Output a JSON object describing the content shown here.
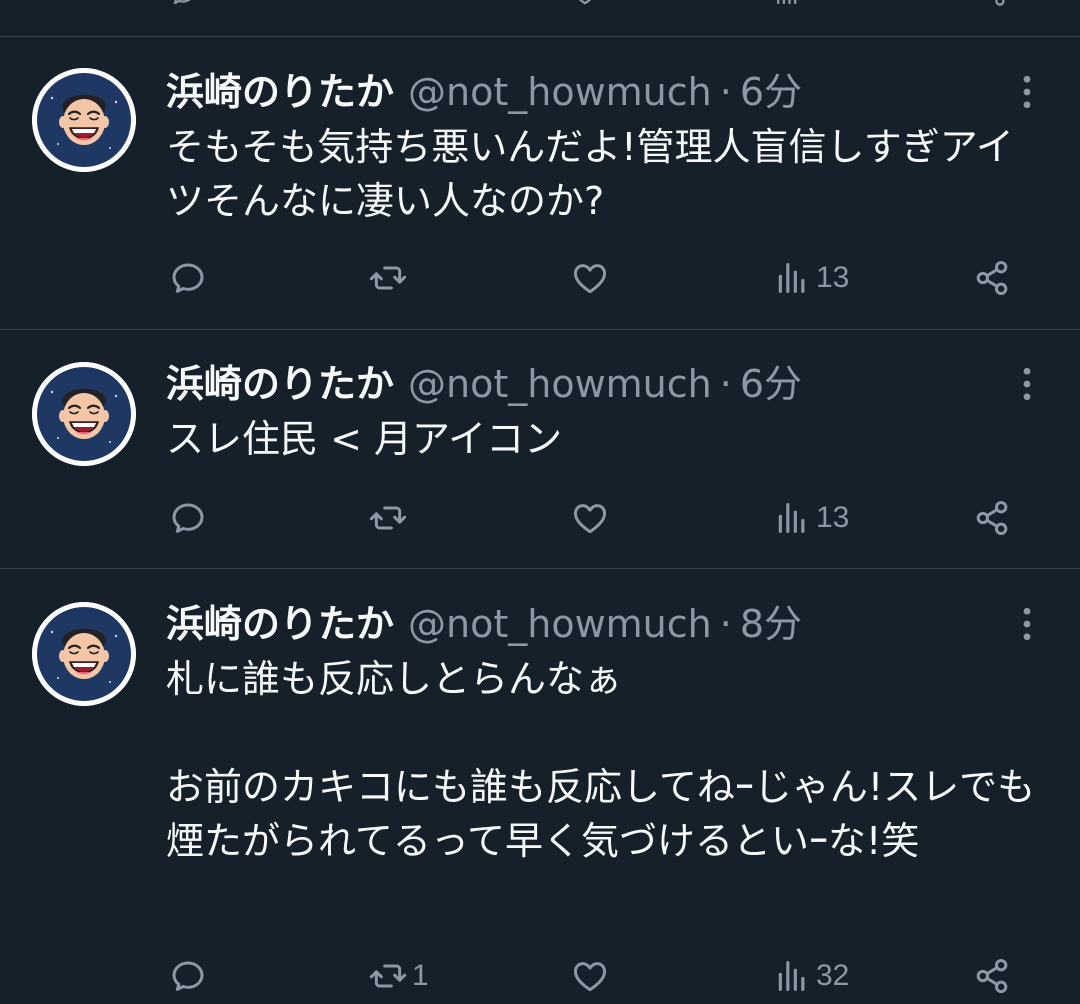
{
  "colors": {
    "background": "#15202b",
    "divider": "#38444d",
    "text": "#f7f9f9",
    "muted": "#8b98a5"
  },
  "tweets": [
    {
      "display_name": "浜崎のりたか",
      "handle": "@not_howmuch",
      "separator": "·",
      "time": "6分",
      "text": "そもそも気持ち悪いんだよ!管理人盲信しすぎアイツそんなに凄い人なのか?",
      "replies": "",
      "retweets": "",
      "likes": "",
      "views": "13",
      "icons": [
        "avatar",
        "more-icon",
        "reply-icon",
        "retweet-icon",
        "like-icon",
        "views-icon",
        "share-icon"
      ]
    },
    {
      "display_name": "浜崎のりたか",
      "handle": "@not_howmuch",
      "separator": "·",
      "time": "6分",
      "text": "スレ住民 < 月アイコン",
      "replies": "",
      "retweets": "",
      "likes": "",
      "views": "13",
      "icons": [
        "avatar",
        "more-icon",
        "reply-icon",
        "retweet-icon",
        "like-icon",
        "views-icon",
        "share-icon"
      ]
    },
    {
      "display_name": "浜崎のりたか",
      "handle": "@not_howmuch",
      "separator": "·",
      "time": "8分",
      "text": "札に誰も反応しとらんなぁ\n\nお前のカキコにも誰も反応してねｰじゃん!スレでも煙たがられてるって早く気づけるといｰな!笑",
      "replies": "",
      "retweets": "1",
      "likes": "",
      "views": "32",
      "icons": [
        "avatar",
        "more-icon",
        "reply-icon",
        "retweet-icon",
        "like-icon",
        "views-icon",
        "share-icon"
      ]
    }
  ]
}
